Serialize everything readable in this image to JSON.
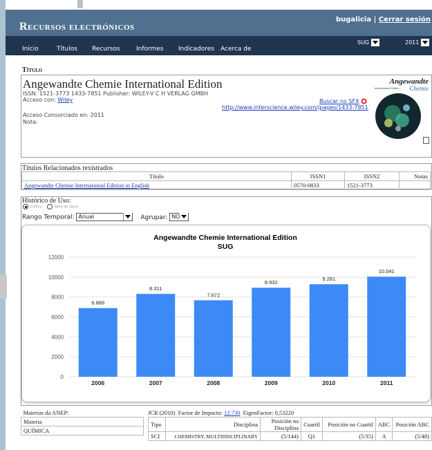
{
  "header": {
    "brand": "Recursos electrónicos",
    "user": "bugalicia",
    "separator": "|",
    "logout": "Cerrar sesión"
  },
  "nav": {
    "items": [
      "Inicio",
      "Títulos",
      "Recursos",
      "Informes",
      "Indicadores",
      "Acerca de"
    ],
    "selects": [
      "SUG",
      "2011"
    ]
  },
  "title_section": {
    "heading": "Título",
    "journal_title": "Angewandte Chemie International Edition",
    "issn_line": "ISSN: 1521-3773   1433-7851   Publisher: WILEY-V C H VERLAG GMBH",
    "access_label": "Acceso con:",
    "access_value": "Wiley",
    "consortium": "Acceso Consorciado en: 2011",
    "note": "Nota:",
    "sfx_link": "Buscar no SFX",
    "url": "http://www.interscience.wiley.com/jpages/1433-7851",
    "cover": {
      "logo_line1": "Angewandte",
      "logo_line2": "Chemie",
      "sub": "International Edition"
    }
  },
  "related": {
    "heading": "Títulos Relacionados rexistrados",
    "columns": [
      "Título",
      "ISSN1",
      "ISSN2",
      "Notas"
    ],
    "rows": [
      {
        "title": "Angewandte Chemie International Edition in English",
        "issn1": "0570-0833",
        "issn2": "1521-3773",
        "notas": ""
      }
    ]
  },
  "usage": {
    "heading": "Histórico de Uso:",
    "radio_graph": "Gráfico",
    "radio_table": "Tabla de datos",
    "range_label": "Rango Temporal:",
    "range_value": "Anual",
    "group_label": "Agrupar:",
    "group_value": "NON"
  },
  "chart_data": {
    "type": "bar",
    "title": "Angewandte Chemie International Edition",
    "subtitle": "SUG",
    "categories": [
      "2006",
      "2007",
      "2008",
      "2009",
      "2010",
      "2011"
    ],
    "values": [
      6888,
      8311,
      7672,
      8932,
      9281,
      10041
    ],
    "value_labels": [
      "6.888",
      "8.311",
      "7.672",
      "8.932",
      "9.281",
      "10.041"
    ],
    "yticks": [
      "0",
      "2000",
      "4000",
      "6000",
      "8000",
      "10000",
      "12000"
    ],
    "ylim": [
      0,
      12000
    ],
    "bar_color": "#3d8af7",
    "grid": true
  },
  "anep": {
    "heading": "Materias da ANEP:",
    "column": "Materia",
    "value": "QUÍMICA"
  },
  "jcr": {
    "prefix": "JCR",
    "year": "(2010)",
    "impact_label": "Factor de Impacto:",
    "impact_value": "12.730",
    "eigen": "EigenFactor: 0,53220",
    "columns": [
      "Tipo",
      "Disciplina",
      "Posición na Disciplina",
      "Cuartil",
      "Posición no Cuartil",
      "ABC",
      "Posición ABC"
    ],
    "row": [
      "SCI",
      "CHEMISTRY, MULTIDISCIPLINARY",
      "(5/144)",
      "Q1",
      "(5/35)",
      "A",
      "(5/48)"
    ]
  }
}
